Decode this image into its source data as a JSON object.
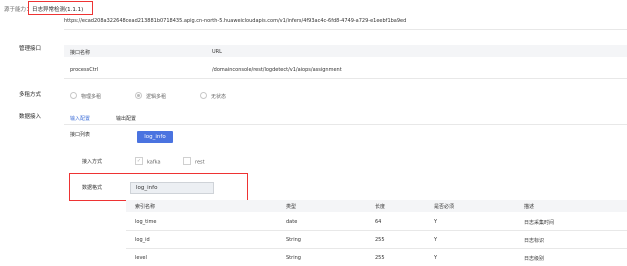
{
  "header": {
    "source_label": "源于能力：",
    "capability_name": "日志异常检测(1.1.1)"
  },
  "endpoint_url": "https://ecad208a322648cead213881b0718435.apig.cn-north-5.huaweicloudapis.com/v1/infers/4f93ac4c-6fd8-4749-a729-e1eebf1ba9ed",
  "management": {
    "label": "管理接口",
    "columns": [
      "接口名称",
      "URL"
    ],
    "rows": [
      {
        "name": "processCtrl",
        "url": "/domainconsole/rest/logdetect/v1/aiops/assignment"
      }
    ]
  },
  "tenancy": {
    "label": "多租方式",
    "options": [
      "物理多租",
      "逻辑多租",
      "无状态"
    ],
    "selected": "逻辑多租"
  },
  "data_access": {
    "label": "数据接入",
    "tabs": [
      "输入配置",
      "输出配置"
    ],
    "active_tab": "输入配置",
    "interface_list_label": "接口列表",
    "interface_button": "log_info",
    "access_method_label": "接入方式",
    "access_methods": [
      "kafka",
      "rest"
    ],
    "data_format_label": "数据格式",
    "data_format_value": "log_info",
    "table": {
      "columns": [
        "索引名称",
        "类型",
        "长度",
        "是否必须",
        "描述"
      ],
      "rows": [
        {
          "name": "log_time",
          "type": "date",
          "length": "64",
          "required": "Y",
          "desc": "日志采集时间"
        },
        {
          "name": "log_id",
          "type": "String",
          "length": "255",
          "required": "Y",
          "desc": "日志标识"
        },
        {
          "name": "level",
          "type": "String",
          "length": "255",
          "required": "Y",
          "desc": "日志级别"
        }
      ]
    }
  },
  "colors": {
    "accent": "#4a73e0",
    "highlight_border": "#e33333",
    "header_bg": "#f4f5f7"
  }
}
